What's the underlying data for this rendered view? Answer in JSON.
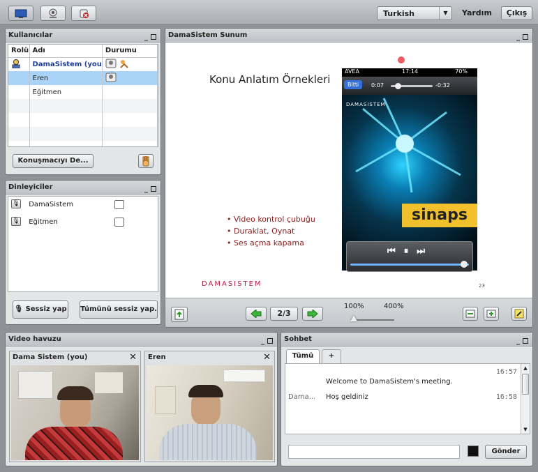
{
  "topbar": {
    "icons": [
      "monitor-icon",
      "webcam-icon",
      "mute-icon"
    ],
    "language": "Turkish",
    "help": "Yardım",
    "exit": "Çıkış"
  },
  "users_panel": {
    "title": "Kullanıcılar",
    "columns": [
      "Rolü",
      "Adı",
      "Durumu"
    ],
    "rows": [
      {
        "name": "DamaSistem (you"
      },
      {
        "name": "Eren"
      },
      {
        "name": "Eğitmen"
      }
    ],
    "speaker_button": "Konuşmacıyı De..."
  },
  "listeners_panel": {
    "title": "Dinleyiciler",
    "items": [
      "DamaSistem",
      "Eğitmen"
    ],
    "mute_button": "Sessiz yap",
    "mute_all_button": "Tümünü sessiz yap."
  },
  "presentation": {
    "title": "DamaSistem Sunum",
    "slide_title": "Konu Anlatım Örnekleri",
    "bullets": [
      "Video kontrol çubuğu",
      "Duraklat, Oynat",
      "Ses açma kapama"
    ],
    "logo": "DamaSistem",
    "phone": {
      "carrier": "AVEA",
      "time": "17:14",
      "battery": "70%",
      "done": "Bitti",
      "elapsed": "0:07",
      "remaining": "-0:32",
      "brand": "DamaSistem",
      "word": "sinaps"
    },
    "slide_number": "23",
    "page": "2/3",
    "zoom_100": "100%",
    "zoom_400": "400%"
  },
  "video_pool": {
    "title": "Video havuzu",
    "videos": [
      {
        "name": "Dama Sistem (you)"
      },
      {
        "name": "Eren"
      }
    ]
  },
  "chat": {
    "title": "Sohbet",
    "tabs": [
      "Tümü",
      "+"
    ],
    "messages": [
      {
        "sender": "",
        "text": "Welcome to DamaSistem's meeting.",
        "time": "16:57"
      },
      {
        "sender": "Dama...",
        "text": "Hoş geldiniz",
        "time": "16:58"
      }
    ],
    "send_button": "Gönder"
  }
}
